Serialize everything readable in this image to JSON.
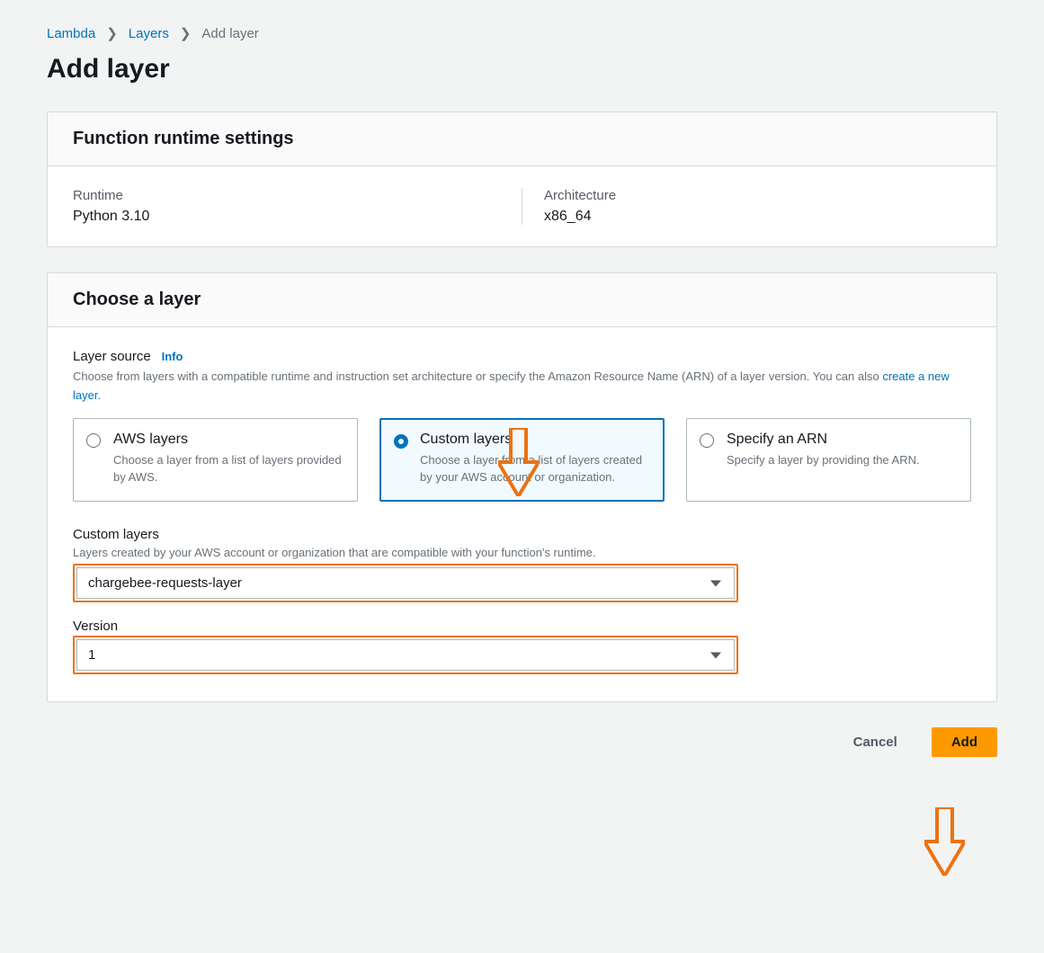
{
  "breadcrumb": {
    "items": [
      "Lambda",
      "Layers"
    ],
    "current": "Add layer"
  },
  "page_title": "Add layer",
  "runtime_panel": {
    "heading": "Function runtime settings",
    "runtime_label": "Runtime",
    "runtime_value": "Python 3.10",
    "arch_label": "Architecture",
    "arch_value": "x86_64"
  },
  "choose_panel": {
    "heading": "Choose a layer",
    "source_label": "Layer source",
    "info_label": "Info",
    "helper_text_1": "Choose from layers with a compatible runtime and instruction set architecture or specify the Amazon Resource Name (ARN) of a layer version. You can also ",
    "helper_link": "create a new layer",
    "helper_text_2": ".",
    "options": [
      {
        "title": "AWS layers",
        "desc": "Choose a layer from a list of layers provided by AWS.",
        "selected": false
      },
      {
        "title": "Custom layers",
        "desc": "Choose a layer from a list of layers created by your AWS account or organization.",
        "selected": true
      },
      {
        "title": "Specify an ARN",
        "desc": "Specify a layer by providing the ARN.",
        "selected": false
      }
    ],
    "custom_layers_label": "Custom layers",
    "custom_layers_helper": "Layers created by your AWS account or organization that are compatible with your function's runtime.",
    "custom_layers_value": "chargebee-requests-layer",
    "version_label": "Version",
    "version_value": "1"
  },
  "buttons": {
    "cancel": "Cancel",
    "add": "Add"
  }
}
